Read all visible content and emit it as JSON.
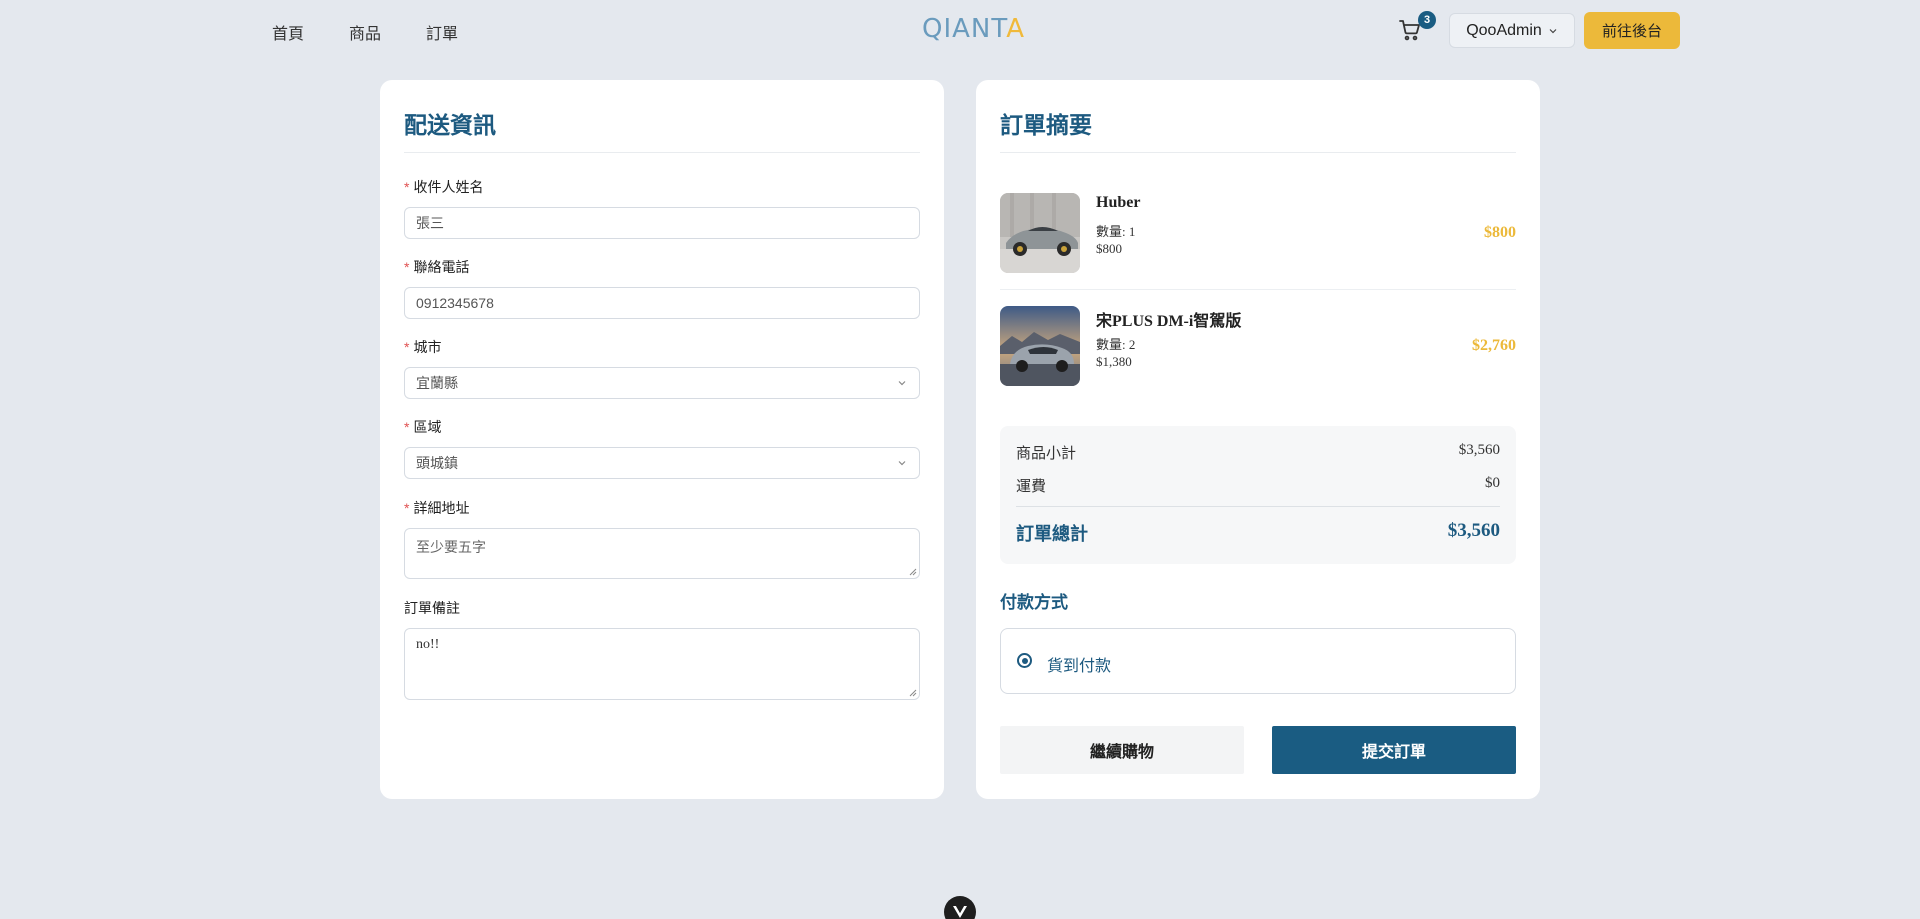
{
  "header": {
    "nav": [
      "首頁",
      "商品",
      "訂單"
    ],
    "logo_main": "QIANT",
    "logo_accent": "A",
    "cart_count": "3",
    "user_name": "QooAdmin",
    "admin_button": "前往後台"
  },
  "shipping": {
    "title": "配送資訊",
    "name_label": "收件人姓名",
    "name_value": "張三",
    "phone_label": "聯絡電話",
    "phone_value": "0912345678",
    "city_label": "城市",
    "city_value": "宜蘭縣",
    "district_label": "區域",
    "district_value": "頭城鎮",
    "address_label": "詳細地址",
    "address_placeholder": "至少要五字",
    "note_label": "訂單備註",
    "note_value": "no!!",
    "required_mark": "*"
  },
  "order": {
    "title": "訂單摘要",
    "items": [
      {
        "name": "Huber",
        "qty": "數量: 1",
        "unit_price": "$800",
        "total": "$800"
      },
      {
        "name": "宋PLUS DM-i智駕版",
        "qty": "數量: 2",
        "unit_price": "$1,380",
        "total": "$2,760"
      }
    ],
    "subtotal_label": "商品小計",
    "subtotal_value": "$3,560",
    "shipping_label": "運費",
    "shipping_value": "$0",
    "total_label": "訂單總計",
    "total_value": "$3,560",
    "payment_title": "付款方式",
    "payment_option": "貨到付款",
    "continue_button": "繼續購物",
    "submit_button": "提交訂單"
  },
  "colors": {
    "primary": "#1a5c82",
    "accent": "#ecb93a",
    "background": "#e4e8ee",
    "required": "#e05252"
  },
  "icons": [
    "cart-icon",
    "chevron-down-icon",
    "radio-selected-icon",
    "vue-devtools-icon"
  ]
}
